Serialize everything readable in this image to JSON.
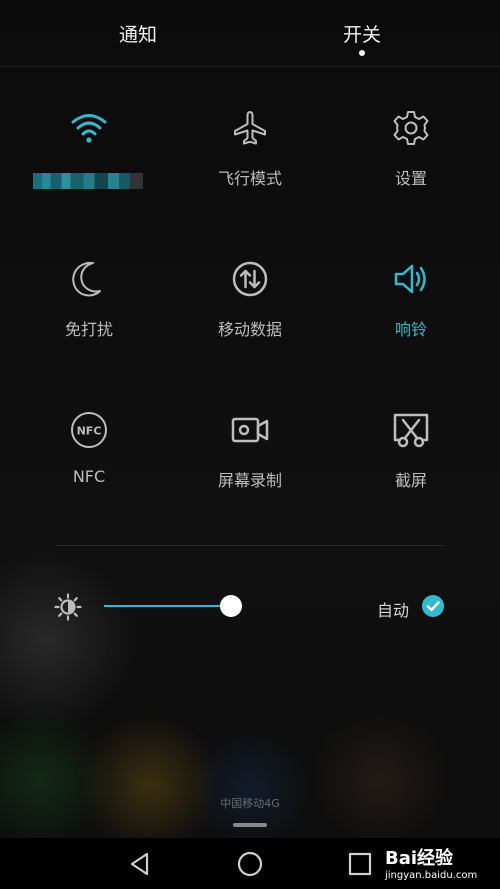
{
  "header": {
    "tabs": [
      {
        "label": "通知",
        "active": false
      },
      {
        "label": "开关",
        "active": true
      }
    ]
  },
  "tiles": [
    {
      "name": "wifi",
      "label": "",
      "icon": "wifi-icon",
      "active": true
    },
    {
      "name": "airplane",
      "label": "飞行模式",
      "icon": "airplane-icon",
      "active": false
    },
    {
      "name": "settings",
      "label": "设置",
      "icon": "gear-icon",
      "active": false
    },
    {
      "name": "dnd",
      "label": "免打扰",
      "icon": "moon-icon",
      "active": false
    },
    {
      "name": "mobile-data",
      "label": "移动数据",
      "icon": "data-arrows-icon",
      "active": false
    },
    {
      "name": "ringer",
      "label": "响铃",
      "icon": "speaker-icon",
      "active": true
    },
    {
      "name": "nfc",
      "label": "NFC",
      "icon": "nfc-icon",
      "active": false
    },
    {
      "name": "screen-record",
      "label": "屏幕录制",
      "icon": "video-camera-icon",
      "active": false
    },
    {
      "name": "screenshot",
      "label": "截屏",
      "icon": "scissors-icon",
      "active": false
    }
  ],
  "brightness": {
    "icon": "brightness-icon",
    "level": 0.86,
    "auto_label": "自动",
    "auto_enabled": true
  },
  "status": {
    "carrier": "中国移动4G"
  },
  "navbar": {
    "buttons": [
      "back-icon",
      "home-icon",
      "recents-icon"
    ]
  },
  "watermark": {
    "logo": "Bai经验",
    "url": "jingyan.baidu.com"
  },
  "colors": {
    "accent": "#33b9d0",
    "background": "#0d0d0d",
    "text": "#bdbdbd"
  }
}
